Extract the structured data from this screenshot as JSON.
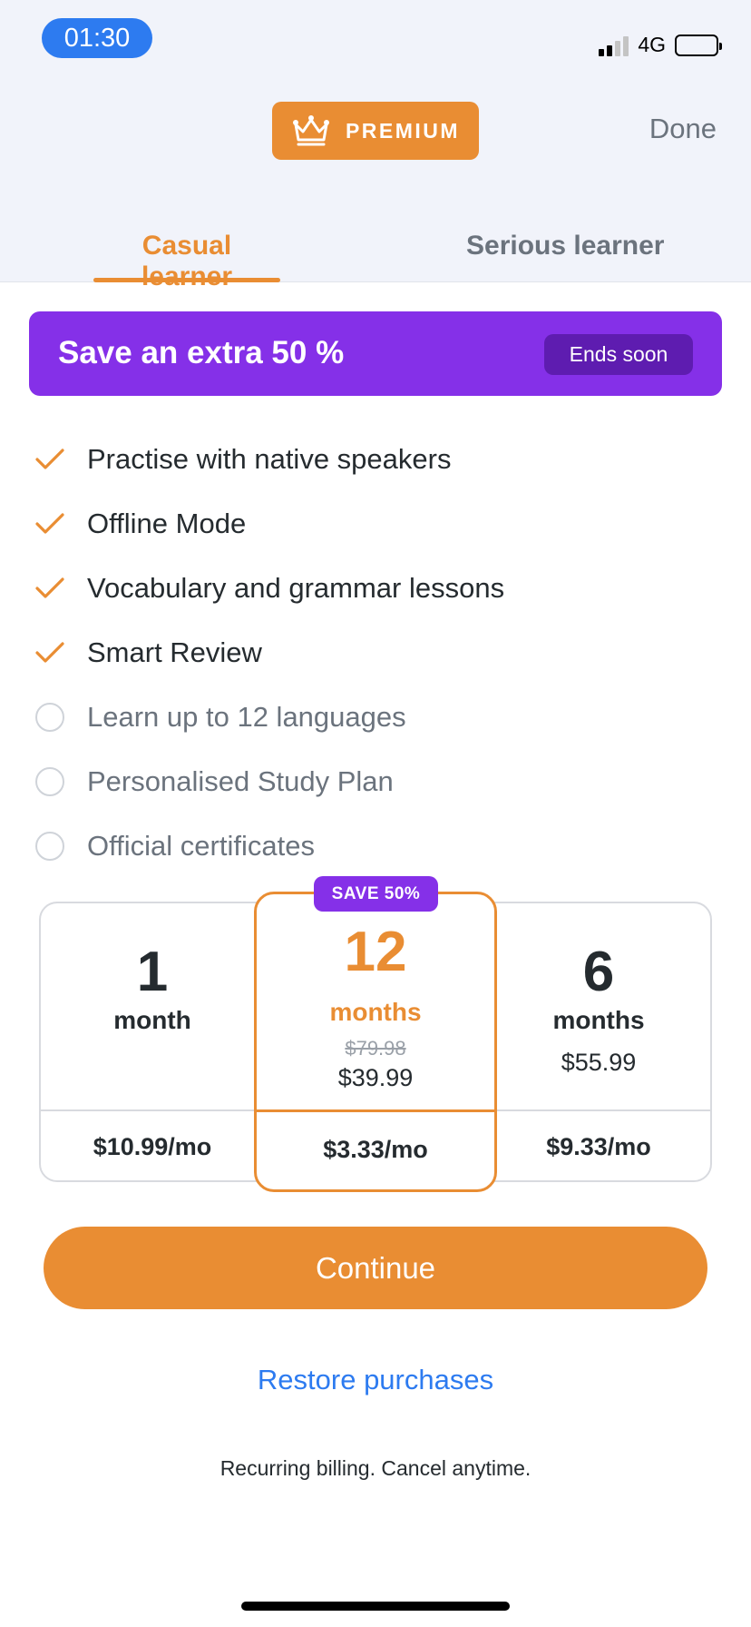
{
  "status_bar": {
    "time": "01:30",
    "network": "4G"
  },
  "header": {
    "badge_label": "PREMIUM",
    "done_label": "Done"
  },
  "tabs": [
    {
      "label": "Casual learner",
      "active": true
    },
    {
      "label": "Serious learner",
      "active": false
    }
  ],
  "promo": {
    "title": "Save an extra 50 %",
    "pill": "Ends soon"
  },
  "features": [
    {
      "label": "Practise with native speakers",
      "included": true
    },
    {
      "label": "Offline Mode",
      "included": true
    },
    {
      "label": "Vocabulary and grammar lessons",
      "included": true
    },
    {
      "label": "Smart Review",
      "included": true
    },
    {
      "label": "Learn up to 12 languages",
      "included": false
    },
    {
      "label": "Personalised Study Plan",
      "included": false
    },
    {
      "label": "Official certificates",
      "included": false
    }
  ],
  "plans": {
    "one_month": {
      "num": "1",
      "unit": "month",
      "per": "$10.99/mo"
    },
    "twelve_months": {
      "badge": "SAVE 50%",
      "num": "12",
      "unit": "months",
      "old_price": "$79.98",
      "price": "$39.99",
      "per": "$3.33/mo",
      "selected": true
    },
    "six_months": {
      "num": "6",
      "unit": "months",
      "price": "$55.99",
      "per": "$9.33/mo"
    }
  },
  "continue_label": "Continue",
  "restore_label": "Restore purchases",
  "billing_note": "Recurring billing. Cancel anytime.",
  "colors": {
    "accent": "#e98d33",
    "promo": "#8530e8",
    "link": "#2d7bf0"
  }
}
